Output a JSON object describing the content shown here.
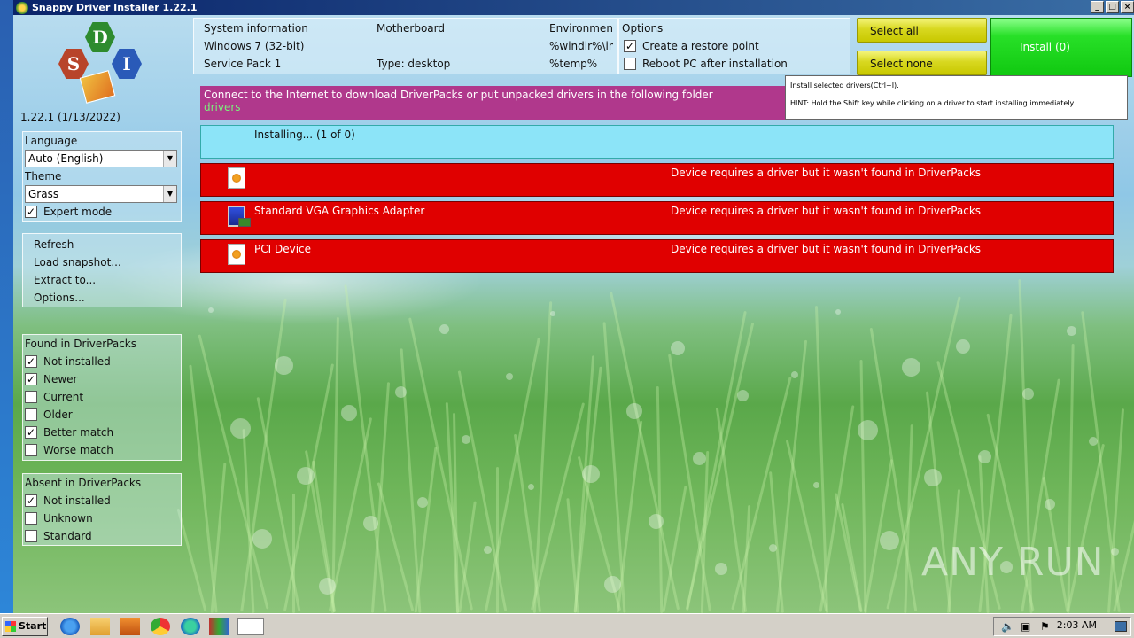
{
  "window": {
    "title": "Snappy Driver Installer 1.22.1"
  },
  "sidebar": {
    "version": "1.22.1 (1/13/2022)",
    "language_label": "Language",
    "language_value": "Auto (English)",
    "theme_label": "Theme",
    "theme_value": "Grass",
    "expert_mode": {
      "label": "Expert mode",
      "checked": true
    },
    "menu": [
      "Refresh",
      "Load snapshot...",
      "Extract to...",
      "Options..."
    ],
    "found_title": "Found in DriverPacks",
    "found_filters": [
      {
        "label": "Not installed",
        "checked": true
      },
      {
        "label": "Newer",
        "checked": true
      },
      {
        "label": "Current",
        "checked": false
      },
      {
        "label": "Older",
        "checked": false
      },
      {
        "label": "Better match",
        "checked": true
      },
      {
        "label": "Worse match",
        "checked": false
      }
    ],
    "absent_title": "Absent in DriverPacks",
    "absent_filters": [
      {
        "label": "Not installed",
        "checked": true
      },
      {
        "label": "Unknown",
        "checked": false
      },
      {
        "label": "Standard",
        "checked": false
      }
    ]
  },
  "sysinfo": {
    "c1": [
      "System information",
      "Windows 7 (32-bit)",
      "Service Pack 1"
    ],
    "c2": [
      "Motherboard",
      "",
      "Type: desktop"
    ],
    "c3": [
      "Environment",
      "%windir%\\inf",
      "%temp%"
    ]
  },
  "options": {
    "title": "Options",
    "restore_point": {
      "label": "Create a restore point",
      "checked": true
    },
    "reboot": {
      "label": "Reboot PC after installation",
      "checked": false
    }
  },
  "buttons": {
    "select_all": "Select all",
    "select_none": "Select none",
    "install": "Install (0)"
  },
  "tooltip": {
    "line1": "Install selected drivers(Ctrl+I).",
    "line2": "HINT: Hold the Shift key while clicking on a driver to start installing immediately."
  },
  "message": {
    "text": "Connect to the Internet to download DriverPacks or put unpacked drivers in the following folder",
    "folder": "drivers"
  },
  "installing": "Installing...  (1 of 0)",
  "drivers": [
    {
      "name": "",
      "icon": "unknown-device-icon",
      "status": "Device requires a driver but it wasn't found in DriverPacks"
    },
    {
      "name": "Standard VGA Graphics Adapter",
      "icon": "monitor-icon",
      "status": "Device requires a driver but it wasn't found in DriverPacks"
    },
    {
      "name": "PCI Device",
      "icon": "unknown-device-icon",
      "status": "Device requires a driver but it wasn't found in DriverPacks"
    }
  ],
  "watermark": "ANY RUN",
  "taskbar": {
    "start": "Start",
    "clock": "2:03 AM"
  },
  "colors": {
    "status_red": "#e00000",
    "message_purple": "#b0388c",
    "installing_cyan": "#8ce4f8",
    "install_green": "#28e028"
  }
}
